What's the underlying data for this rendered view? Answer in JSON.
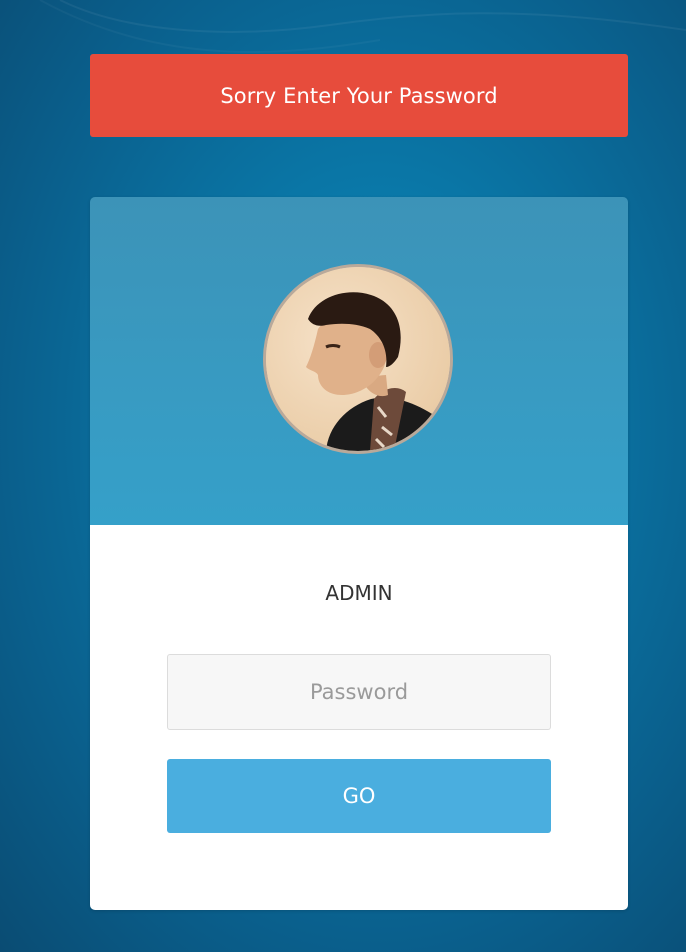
{
  "alert": {
    "message": "Sorry Enter Your Password",
    "color": "#e74c3c"
  },
  "login": {
    "username": "ADMIN",
    "avatar_alt": "user-avatar",
    "password": {
      "value": "",
      "placeholder": "Password"
    },
    "submit_label": "GO"
  },
  "colors": {
    "background": "#0a76a6",
    "header": "#35a0c9",
    "button": "#4aaedf"
  }
}
